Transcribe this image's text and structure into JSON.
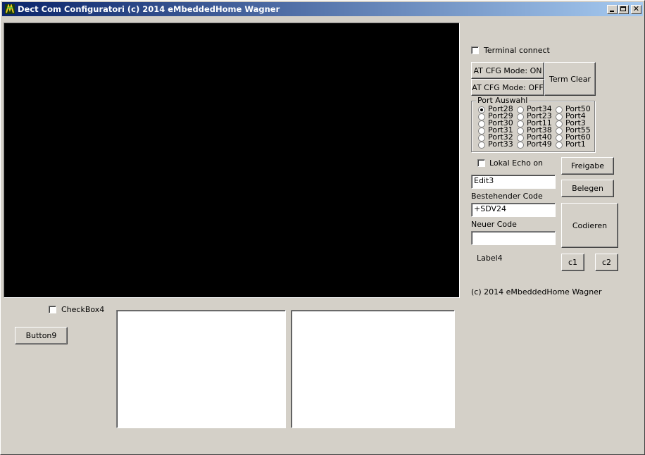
{
  "window": {
    "title": "Dect Com Configuratori (c) 2014 eMbeddedHome Wagner"
  },
  "controls": {
    "minimize": "minimize",
    "maximize": "maximize",
    "close": "✕"
  },
  "terminal_connect": {
    "label": "Terminal connect",
    "checked": false
  },
  "buttons": {
    "at_cfg_on": "AT CFG Mode: ON",
    "at_cfg_off": "AT CFG Mode: OFF",
    "term_clear": "Term Clear",
    "freigabe": "Freigabe",
    "belegen": "Belegen",
    "codieren": "Codieren",
    "c1": "c1",
    "c2": "c2",
    "button9": "Button9"
  },
  "port_group": {
    "title": "Port Auswahl",
    "ports": [
      {
        "label": "Port28",
        "selected": true
      },
      {
        "label": "Port29",
        "selected": false
      },
      {
        "label": "Port30",
        "selected": false
      },
      {
        "label": "Port31",
        "selected": false
      },
      {
        "label": "Port32",
        "selected": false
      },
      {
        "label": "Port33",
        "selected": false
      },
      {
        "label": "Port34",
        "selected": false
      },
      {
        "label": "Port23",
        "selected": false
      },
      {
        "label": "Port11",
        "selected": false
      },
      {
        "label": "Port38",
        "selected": false
      },
      {
        "label": "Port40",
        "selected": false
      },
      {
        "label": "Port49",
        "selected": false
      },
      {
        "label": "Port50",
        "selected": false
      },
      {
        "label": "Port4",
        "selected": false
      },
      {
        "label": "Port3",
        "selected": false
      },
      {
        "label": "Port55",
        "selected": false
      },
      {
        "label": "Port60",
        "selected": false
      },
      {
        "label": "Port1",
        "selected": false
      }
    ]
  },
  "lokal_echo": {
    "label": "Lokal Echo on",
    "checked": false
  },
  "edit3": {
    "value": "Edit3"
  },
  "bestehender_code": {
    "label": "Bestehender Code",
    "value": "+SDV24"
  },
  "neuer_code": {
    "label": "Neuer Code",
    "value": ""
  },
  "label4": "Label4",
  "copyright": "(c) 2014 eMbeddedHome Wagner",
  "checkbox4": {
    "label": "CheckBox4",
    "checked": false
  }
}
